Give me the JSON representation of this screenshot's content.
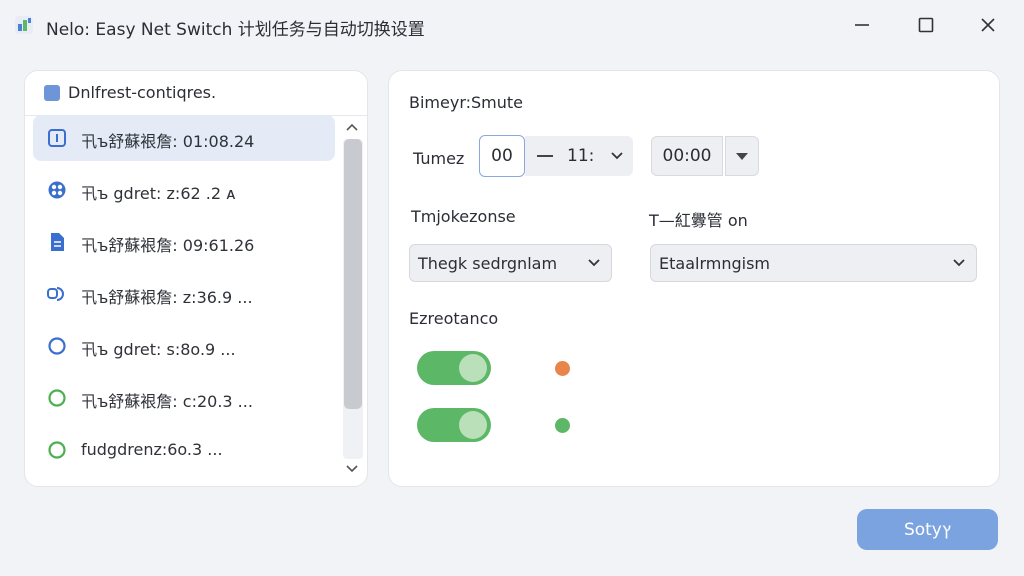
{
  "window": {
    "title": "Nelo: Easy Net Switch 计划任务与自动切换设置",
    "app_icon": "app-logo-icon",
    "controls": [
      "minimize-icon",
      "maximize-icon",
      "close-icon"
    ]
  },
  "list": {
    "header": "Dnlfrest-contiqres.",
    "items": [
      {
        "label": "卂ъ舒蘇裉詹: 01:08.24",
        "icon": "info-square-icon",
        "color": "#3b6fcf",
        "selected": true
      },
      {
        "label": "卂ъ gdret: z:62 .2 ᴀ",
        "icon": "film-reel-icon",
        "color": "#3b6fcf",
        "selected": false
      },
      {
        "label": "卂ъ舒蘇裉詹: 09:61.26",
        "icon": "document-icon",
        "color": "#3b6fcf",
        "selected": false
      },
      {
        "label": "卂ъ舒蘇裉詹: z:36.9 ...",
        "icon": "chat-bubbles-icon",
        "color": "#3b6fcf",
        "selected": false
      },
      {
        "label": "卂ъ gdret: s:8o.9 ...",
        "icon": "circle-icon",
        "color": "#3b6fcf",
        "selected": false
      },
      {
        "label": "卂ъ舒蘇裉詹: c:20.3 ...",
        "icon": "circle-icon",
        "color": "#4caf50",
        "selected": false
      },
      {
        "label": "fudgdrenz:6o.3 ...",
        "icon": "circle-icon",
        "color": "#4caf50",
        "selected": false
      }
    ]
  },
  "schedule": {
    "section_label": "Bimeyr:Smute",
    "time_label": "Tumez",
    "minute_value": "00",
    "hour_value": "11:",
    "time2_value": "00:00"
  },
  "options": {
    "left_label": "Tmjokezonse",
    "right_label": "T—紅釁管 on",
    "left_select": "Thegk sedrgnlam",
    "right_select": "Etaalrmngism"
  },
  "extras": {
    "section_label": "Ezreotanco",
    "toggles": [
      {
        "on": true,
        "status_color": "#e8854a"
      },
      {
        "on": true,
        "status_color": "#5cb867"
      }
    ]
  },
  "footer": {
    "primary_label": "Sotyץ"
  }
}
